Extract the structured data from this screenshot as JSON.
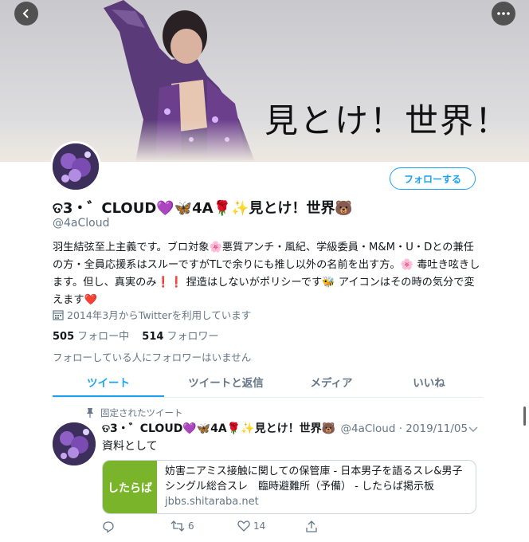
{
  "banner": {
    "text": "見とけ！世界！"
  },
  "profile": {
    "display_name": "ତ3・゛CLOUD💜🦋4A🌹✨見とけ！世界🐻",
    "handle": "@4aCloud",
    "follow_label": "フォローする",
    "bio": "羽生結弦至上主義です。ブロ対象🌸悪質アンチ・風紀、学級委員・M&M・U・Dとの兼任の方・全員応援系はスルーですがTLで余りにも推し以外の名前を出す方。🌸 毒吐き呟きします。但し、真実のみ❗❗ 捏造はしないがポリシーです🐝 アイコンはその時の気分で変えます❤️",
    "joined": "2014年3月からTwitterを利用しています",
    "following_count": "505",
    "following_label": "フォロー中",
    "followers_count": "514",
    "followers_label": "フォロワー",
    "no_mutual": "フォローしている人にフォロワーはいません"
  },
  "tabs": [
    "ツイート",
    "ツイートと返信",
    "メディア",
    "いいね"
  ],
  "tweet": {
    "pinned_label": "固定されたツイート",
    "name": "ତ3・゛CLOUD💜🦋4A🌹✨見とけ！世界🐻",
    "meta": "@4aCloud · 2019/11/05",
    "text": "資料として",
    "card": {
      "logo_text": "したらば",
      "title": "妨害ニアミス接触に関しての保管庫 - 日本男子を語るスレ&男子シングル総合スレ　臨時避難所（予備） - したらば掲示板",
      "domain": "jbbs.shitaraba.net"
    },
    "retweets": "6",
    "likes": "14"
  },
  "colors": {
    "accent": "#1da1f2",
    "muted": "#657786",
    "card_logo_bg": "#7ab42a"
  }
}
